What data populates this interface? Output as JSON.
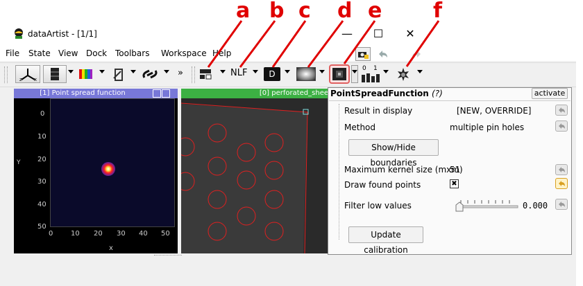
{
  "annotations": [
    "a",
    "b",
    "c",
    "d",
    "e",
    "f"
  ],
  "window": {
    "title": "dataArtist - [1/1]",
    "min": "—",
    "max": "☐",
    "close": "✕"
  },
  "menu": [
    "File",
    "State",
    "View",
    "Dock",
    "Toolbars",
    "Workspace",
    "Help"
  ],
  "toolbar": {
    "overflow": "»",
    "nlf_label": "NLF",
    "d_label": "D",
    "scale_small": "0",
    "scale_mid": "1"
  },
  "left_panel": {
    "title": "[1] Point spread function",
    "y_label": "Y",
    "x_label": "x",
    "y_ticks": [
      "0",
      "10",
      "20",
      "30",
      "40",
      "50"
    ],
    "x_ticks": [
      "0",
      "10",
      "20",
      "30",
      "40",
      "50"
    ]
  },
  "right_panel": {
    "title": "[0] perforated_shee"
  },
  "props": {
    "title": "PointSpreadFunction",
    "help": "(?)",
    "activate": "activate",
    "rows": {
      "result_label": "Result in display",
      "result_value": "[NEW, OVERRIDE]",
      "method_label": "Method",
      "method_value": "multiple pin holes",
      "show_hide": "Show/Hide boundaries",
      "kernel_label": "Maximum kernel size (mxm)",
      "kernel_value": "51",
      "draw_label": "Draw found points",
      "draw_value": "✖",
      "filter_label": "Filter low values",
      "filter_value": "0.000",
      "update": "Update calibration"
    }
  },
  "colors": {
    "accent_red": "#e00000",
    "left_header": "#7878d8",
    "right_header": "#3cb043"
  }
}
